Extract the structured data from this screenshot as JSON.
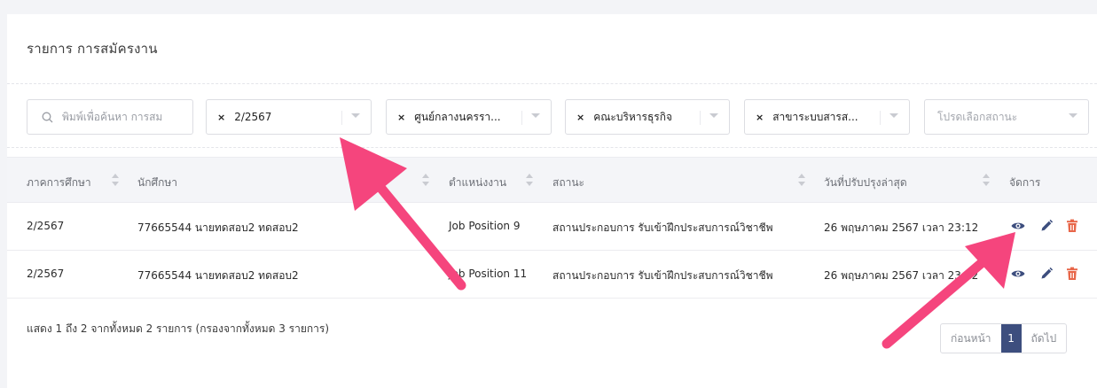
{
  "title": "รายการ การสมัครงาน",
  "filters": {
    "search_placeholder": "พิมพ์เพื่อค้นหา การสม",
    "semester": "2/2567",
    "center": "ศูนย์กลางนครรา...",
    "faculty": "คณะบริหารธุรกิจ",
    "major": "สาขาระบบสารส...",
    "status_placeholder": "โปรดเลือกสถานะ",
    "remove_glyph": "×"
  },
  "table": {
    "headers": {
      "semester": "ภาคการศึกษา",
      "student": "นักศึกษา",
      "position": "ตำแหน่งงาน",
      "status": "สถานะ",
      "updated": "วันที่ปรับปรุงล่าสุด",
      "actions": "จัดการ"
    },
    "rows": [
      {
        "semester": "2/2567",
        "student": "77665544 นายทดสอบ2 ทดสอบ2",
        "position": "Job Position 9",
        "status": "สถานประกอบการ รับเข้าฝึกประสบการณ์วิชาชีพ",
        "updated": "26 พฤษภาคม 2567 เวลา 23:12"
      },
      {
        "semester": "2/2567",
        "student": "77665544 นายทดสอบ2 ทดสอบ2",
        "position": "Job Position 11",
        "status": "สถานประกอบการ รับเข้าฝึกประสบการณ์วิชาชีพ",
        "updated": "26 พฤษภาคม 2567 เวลา 23:12"
      }
    ]
  },
  "footer": {
    "summary": "แสดง 1 ถึง 2 จากทั้งหมด 2 รายการ (กรองจากทั้งหมด 3 รายการ)",
    "prev": "ก่อนหน้า",
    "page": "1",
    "next": "ถัดไป"
  },
  "icons": {
    "view": "eye-icon",
    "edit": "pencil-icon",
    "delete": "trash-icon",
    "search": "search-icon"
  },
  "colors": {
    "view": "#3d4e7e",
    "edit": "#3d4e7e",
    "delete": "#e8674a",
    "page_active": "#3d4e7e",
    "annotation_arrow": "#f5457d"
  }
}
